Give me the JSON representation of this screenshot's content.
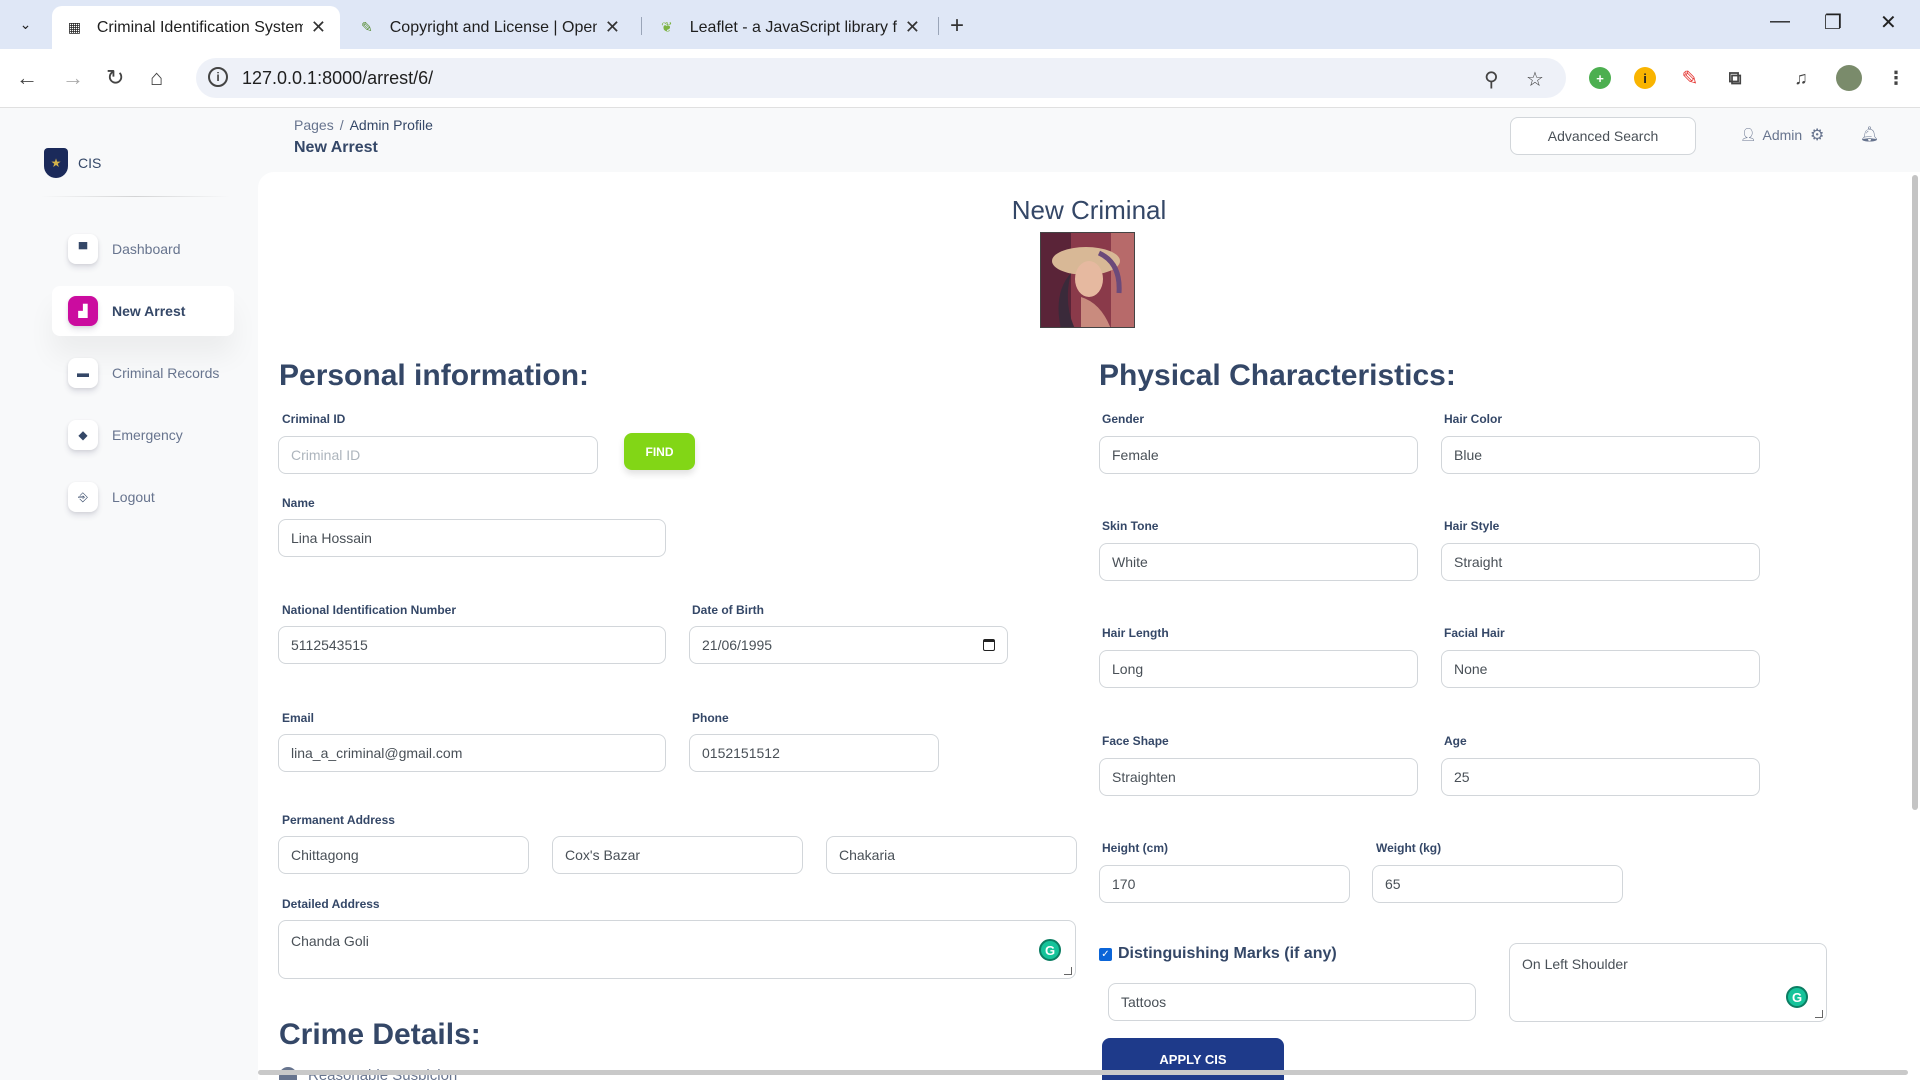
{
  "browser": {
    "tabs": [
      {
        "title": "Criminal Identification System -",
        "active": true
      },
      {
        "title": "Copyright and License | OpenSt",
        "active": false
      },
      {
        "title": "Leaflet - a JavaScript library for",
        "active": false
      }
    ],
    "url": "127.0.0.1:8000/arrest/6/"
  },
  "sidebar": {
    "brand": "CIS",
    "items": [
      {
        "label": "Dashboard",
        "icon": "shop-icon"
      },
      {
        "label": "New Arrest",
        "icon": "office-icon",
        "active": true
      },
      {
        "label": "Criminal Records",
        "icon": "credit-card-icon"
      },
      {
        "label": "Emergency",
        "icon": "box-icon"
      },
      {
        "label": "Logout",
        "icon": "logout-icon"
      }
    ]
  },
  "header": {
    "breadcrumb_root": "Pages",
    "breadcrumb_current": "Admin Profile",
    "page_title": "New Arrest",
    "advanced_search": "Advanced Search",
    "user": "Admin"
  },
  "form": {
    "title": "New Criminal",
    "personal_title": "Personal information:",
    "physical_title": "Physical Characteristics:",
    "crime_title": "Crime Details:",
    "criminal_id": {
      "label": "Criminal ID",
      "placeholder": "Criminal ID",
      "value": ""
    },
    "find_label": "FIND",
    "name": {
      "label": "Name",
      "value": "Lina Hossain"
    },
    "nid": {
      "label": "National Identification Number",
      "value": "5112543515"
    },
    "dob": {
      "label": "Date of Birth",
      "value": "21/06/1995"
    },
    "email": {
      "label": "Email",
      "value": "lina_a_criminal@gmail.com"
    },
    "phone": {
      "label": "Phone",
      "value": "0152151512"
    },
    "permanent_address": {
      "label": "Permanent Address",
      "division": "Chittagong",
      "district": "Cox's Bazar",
      "upazila": "Chakaria"
    },
    "detailed_address": {
      "label": "Detailed Address",
      "value": "Chanda Goli"
    },
    "gender": {
      "label": "Gender",
      "value": "Female"
    },
    "hair_color": {
      "label": "Hair Color",
      "value": "Blue"
    },
    "skin_tone": {
      "label": "Skin Tone",
      "value": "White"
    },
    "hair_style": {
      "label": "Hair Style",
      "value": "Straight"
    },
    "hair_length": {
      "label": "Hair Length",
      "value": "Long"
    },
    "facial_hair": {
      "label": "Facial Hair",
      "value": "None"
    },
    "face_shape": {
      "label": "Face Shape",
      "value": "Straighten"
    },
    "age": {
      "label": "Age",
      "value": "25"
    },
    "height": {
      "label": "Height (cm)",
      "value": "170"
    },
    "weight": {
      "label": "Weight (kg)",
      "value": "65"
    },
    "distinguishing": {
      "label": "Distinguishing Marks (if any)",
      "checked": true,
      "type": "Tattoos",
      "description": "On Left Shoulder"
    },
    "apply_label": "APPLY CIS",
    "crime_reason_peek": "Reasonable Suspicion"
  }
}
